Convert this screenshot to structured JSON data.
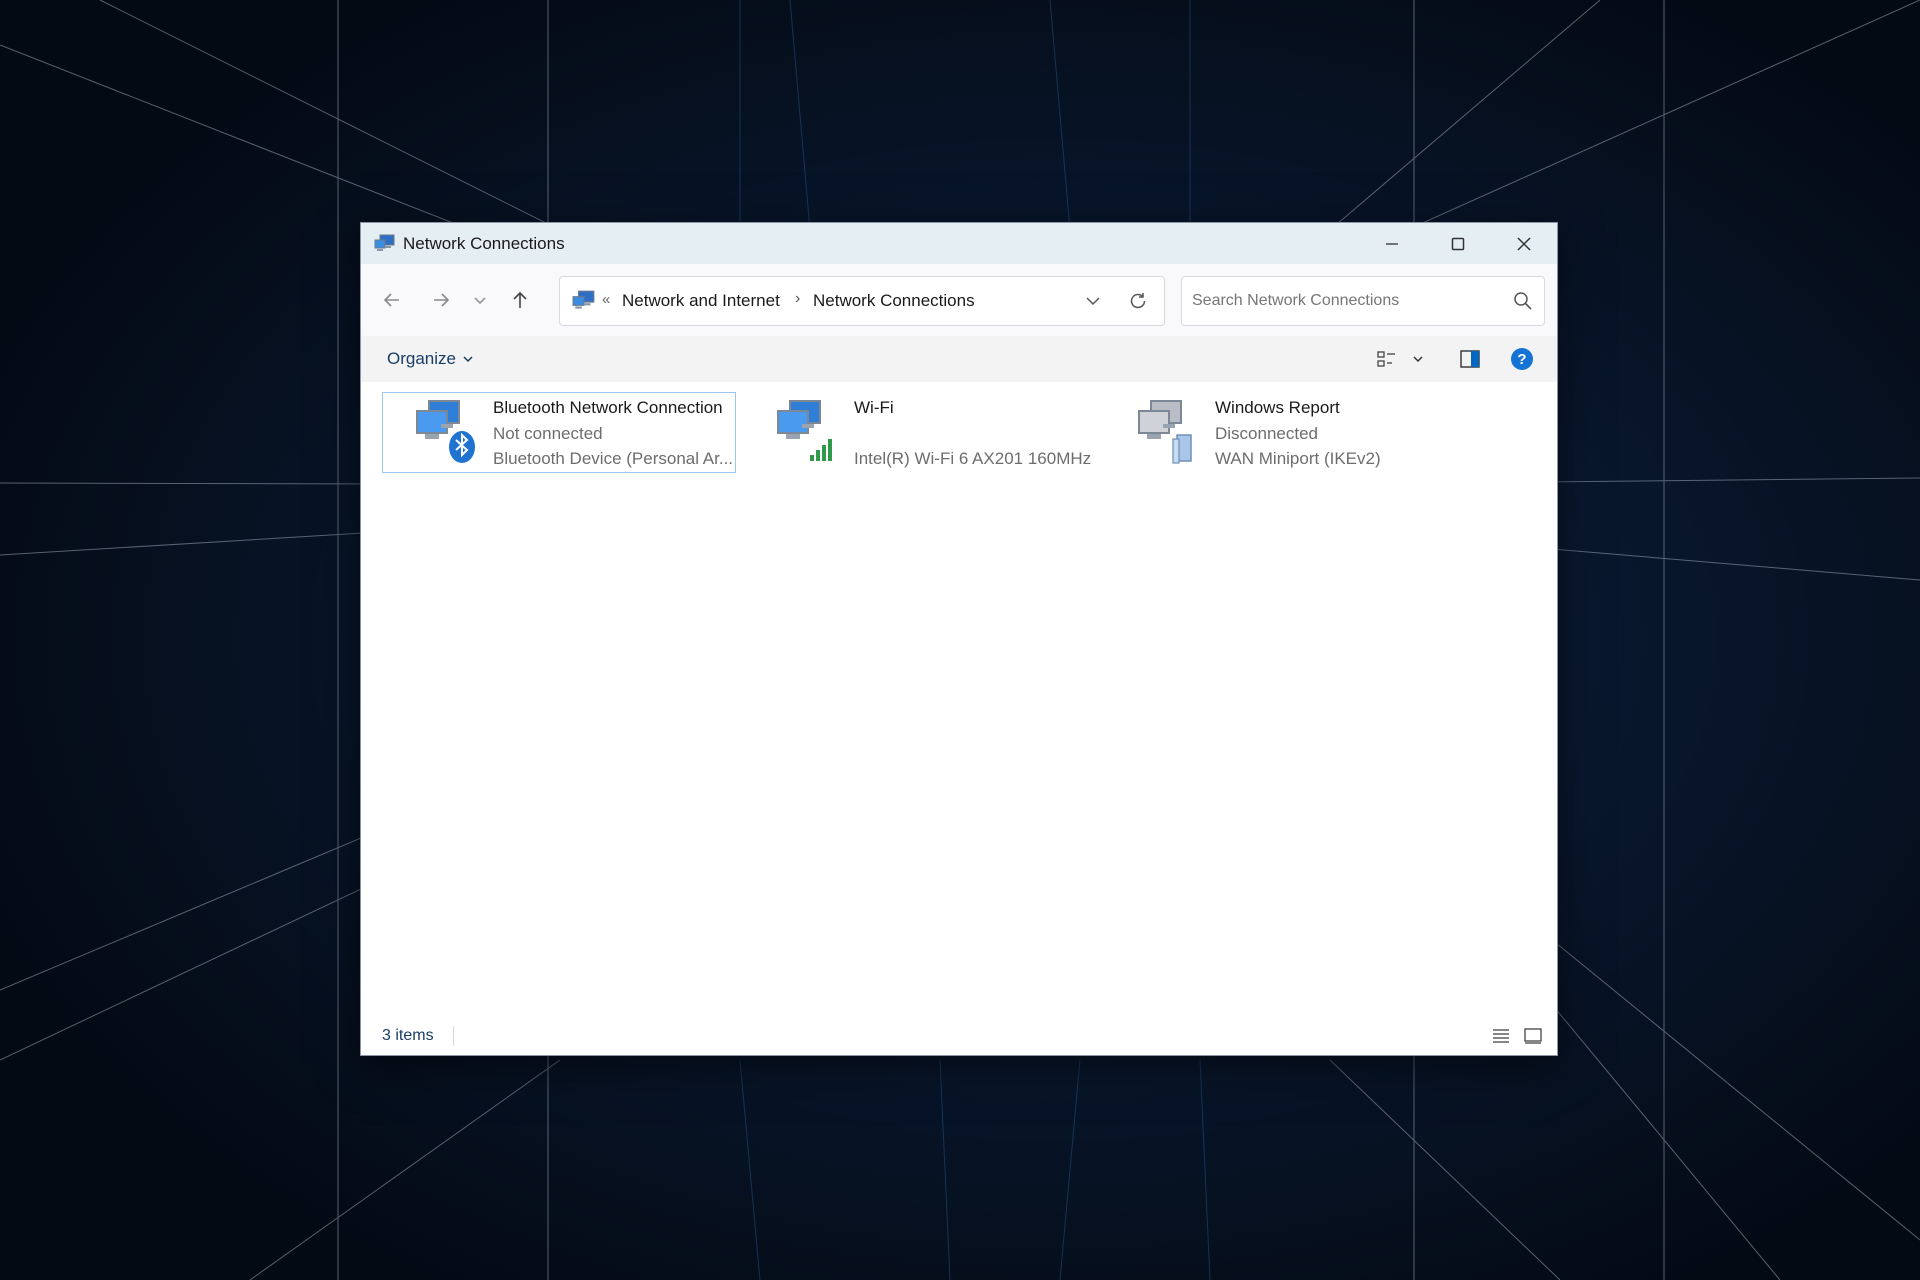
{
  "window": {
    "title": "Network Connections",
    "controls": {
      "minimize": "minimize-icon",
      "maximize": "maximize-icon",
      "close": "close-icon"
    }
  },
  "navigation": {
    "back_icon": "back-arrow-icon",
    "forward_icon": "forward-arrow-icon",
    "recent_icon": "chevron-down-icon",
    "up_icon": "up-arrow-icon"
  },
  "address": {
    "overflow": "«",
    "crumbs": [
      "Network and Internet",
      "Network Connections"
    ],
    "separator": "›"
  },
  "search": {
    "placeholder": "Search Network Connections",
    "value": ""
  },
  "commandbar": {
    "organize_label": "Organize"
  },
  "connections": [
    {
      "name": "Bluetooth Network Connection",
      "status": "Not connected",
      "device": "Bluetooth Device (Personal Ar...",
      "icon": "bluetooth-network-icon",
      "selected": true
    },
    {
      "name": "Wi-Fi",
      "status": "",
      "device": "Intel(R) Wi-Fi 6 AX201 160MHz",
      "icon": "wifi-network-icon",
      "selected": false
    },
    {
      "name": "Windows Report",
      "status": "Disconnected",
      "device": "WAN Miniport (IKEv2)",
      "icon": "vpn-network-icon",
      "selected": false
    }
  ],
  "statusbar": {
    "item_count": "3 items"
  },
  "colors": {
    "accent": "#0067c0",
    "titlebar": "#e4eef3",
    "selection_border": "#99c7f0",
    "background": "#050b16"
  }
}
